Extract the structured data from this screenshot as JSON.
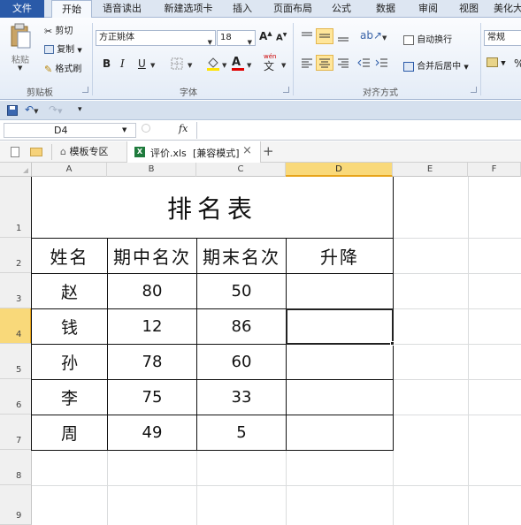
{
  "ribbon_tabs": [
    "文件",
    "开始",
    "语音读出",
    "新建选项卡",
    "插入",
    "页面布局",
    "公式",
    "数据",
    "审阅",
    "视图",
    "美化大"
  ],
  "clipboard": {
    "paste": "粘贴",
    "cut": "剪切",
    "copy": "复制",
    "format_painter": "格式刷",
    "group_label": "剪贴板"
  },
  "font": {
    "name": "方正姚体",
    "size": "18",
    "grow": "A",
    "shrink": "A",
    "bold": "B",
    "italic": "I",
    "underline": "U",
    "font_color_letter": "A",
    "phonetic": "wén",
    "group_label": "字体"
  },
  "alignment": {
    "wrap_text": "自动换行",
    "merge_center": "合并后居中",
    "group_label": "对齐方式"
  },
  "number": {
    "format": "常规",
    "percent": "%"
  },
  "formula_bar": {
    "name_box": "D4",
    "fx": "fx",
    "content": ""
  },
  "doc_tabs": {
    "template_zone": "模板专区",
    "file_name": "评价.xls",
    "mode": "[兼容模式]",
    "close": "×",
    "new": "+"
  },
  "grid": {
    "columns": [
      "A",
      "B",
      "C",
      "D",
      "E",
      "F"
    ],
    "rows": [
      "1",
      "2",
      "3",
      "4",
      "5",
      "6",
      "7",
      "8",
      "9"
    ],
    "selected_column": "D",
    "selected_row": "4",
    "active_cell": "D4"
  },
  "table": {
    "title": "排名表",
    "headers": [
      "姓名",
      "期中名次",
      "期末名次",
      "升降"
    ],
    "rows": [
      {
        "name": "赵",
        "midterm": "80",
        "final": "50",
        "change": ""
      },
      {
        "name": "钱",
        "midterm": "12",
        "final": "86",
        "change": ""
      },
      {
        "name": "孙",
        "midterm": "78",
        "final": "60",
        "change": ""
      },
      {
        "name": "李",
        "midterm": "75",
        "final": "33",
        "change": ""
      },
      {
        "name": "周",
        "midterm": "49",
        "final": "5",
        "change": ""
      }
    ]
  }
}
